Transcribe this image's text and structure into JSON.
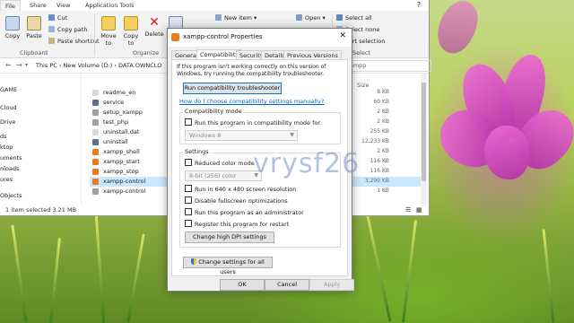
{
  "explorer": {
    "tabs": [
      "File",
      "Share",
      "View",
      "Application Tools"
    ],
    "ribbon": {
      "copy": "Copy",
      "paste": "Paste",
      "cut": "Cut",
      "copy_path": "Copy path",
      "paste_shortcut": "Paste shortcut",
      "move_to": "Move to",
      "copy_to": "Copy to",
      "delete": "Delete",
      "new_item": "New item",
      "open": "Open",
      "select_all": "Select all",
      "select_none": "Select none",
      "invert_selection": "vert selection",
      "groups": {
        "clipboard": "Clipboard",
        "organize": "Organize",
        "select": "Select"
      }
    },
    "breadcrumb": [
      "This PC",
      "New Volume (D:)",
      "DATA OWNCLO"
    ],
    "search_placeholder": "xampp",
    "nav_items": [
      "GAME",
      "Cloud",
      "Drive",
      "ds",
      "ktop",
      "uments",
      "nloads",
      "ures",
      "Objects"
    ],
    "list": {
      "size_header": "Size",
      "files": [
        {
          "name": "readme_en",
          "size": "8 KB",
          "icon": "text-file-icon",
          "color": "#d9d9d9"
        },
        {
          "name": "service",
          "size": "60 KB",
          "icon": "app-icon",
          "color": "#5b6f8f"
        },
        {
          "name": "setup_xampp",
          "size": "2 KB",
          "icon": "batch-file-icon",
          "color": "#a0a0a0"
        },
        {
          "name": "test_php",
          "size": "2 KB",
          "icon": "batch-file-icon",
          "color": "#a0a0a0"
        },
        {
          "name": "uninstall.dat",
          "size": "255 KB",
          "icon": "file-icon",
          "color": "#d9d9d9"
        },
        {
          "name": "uninstall",
          "size": "12,233 KB",
          "icon": "app-icon",
          "color": "#5b6f8f"
        },
        {
          "name": "xampp_shell",
          "size": "2 KB",
          "icon": "xampp-icon",
          "color": "#f07a1a"
        },
        {
          "name": "xampp_start",
          "size": "116 KB",
          "icon": "xampp-icon",
          "color": "#f07a1a"
        },
        {
          "name": "xampp_stop",
          "size": "116 KB",
          "icon": "xampp-icon",
          "color": "#f07a1a"
        },
        {
          "name": "xampp-control",
          "size": "3,290 KB",
          "icon": "xampp-icon",
          "color": "#f07a1a",
          "selected": true
        },
        {
          "name": "xampp-control",
          "size": "1 KB",
          "icon": "config-file-icon",
          "color": "#a0a0a0"
        }
      ]
    },
    "status": {
      "left": "1 item selected  3.21 MB"
    }
  },
  "dialog": {
    "title": "xampp-control Properties",
    "tabs": [
      "General",
      "Compatibility",
      "Security",
      "Details",
      "Previous Versions"
    ],
    "active_tab": "Compatibility",
    "intro": "If this program isn't working correctly on this version of Windows, try running the compatibility troubleshooter.",
    "troubleshooter_button": "Run compatibility troubleshooter",
    "manual_link": "How do I choose compatibility settings manually?",
    "compat_mode": {
      "label": "Compatibility mode",
      "checkbox": "Run this program in compatibility mode for:",
      "select_value": "Windows 8"
    },
    "settings": {
      "label": "Settings",
      "reduced_color": "Reduced color mode",
      "color_select": "8-bit (256) color",
      "run_640": "Run in 640 x 480 screen resolution",
      "disable_fullscreen": "Disable fullscreen optimizations",
      "run_admin": "Run this program as an administrator",
      "register_restart": "Register this program for restart",
      "dpi_button": "Change high DPI settings"
    },
    "all_users_button": "Change settings for all users",
    "ok": "OK",
    "cancel": "Cancel",
    "apply": "Apply"
  },
  "watermark": "vrysf26",
  "colors": {
    "accent": "#0078d7",
    "link": "#0066cc",
    "selection": "#cce8ff",
    "flower": "#d94fd0"
  }
}
